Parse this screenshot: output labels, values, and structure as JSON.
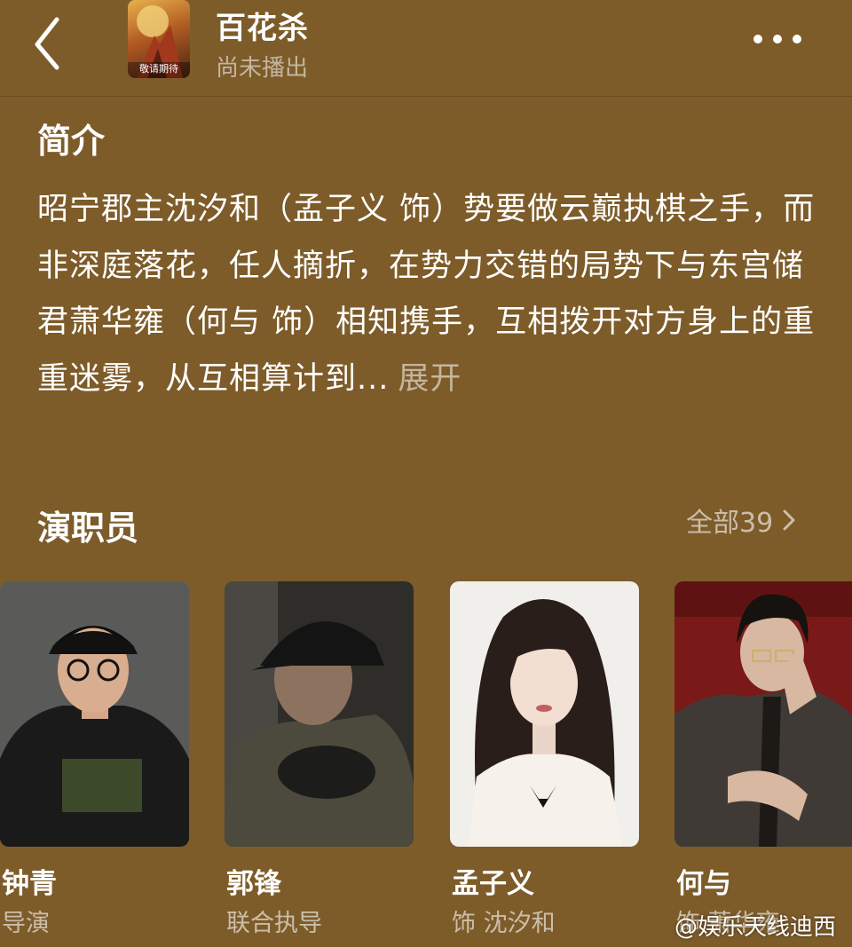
{
  "header": {
    "title": "百花杀",
    "status": "尚未播出",
    "poster_caption": "敬请期待",
    "icons": {
      "back": "chevron-left-icon",
      "more": "more-dots-icon"
    }
  },
  "intro": {
    "heading": "简介",
    "text": "昭宁郡主沈汐和（孟子义 饰）势要做云巅执棋之手，而非深庭落花，任人摘折，在势力交错的局势下与东宫储君萧华雍（何与 饰）相知携手，互相拨开对方身上的重重迷雾，从互相算计到...",
    "expand_label": "展开"
  },
  "cast": {
    "heading": "演职员",
    "see_all_label": "全部39",
    "members": [
      {
        "name": "钟青",
        "role": "导演"
      },
      {
        "name": "郭锋",
        "role": "联合执导"
      },
      {
        "name": "孟子义",
        "role": "饰 沈汐和"
      },
      {
        "name": "何与",
        "role": "饰 萧华雍"
      }
    ]
  },
  "watermark": "@娱乐天线迪西",
  "colors": {
    "background": "#7d5c2a",
    "text": "#ffffff",
    "muted_text": "rgba(255,255,255,0.6)"
  }
}
